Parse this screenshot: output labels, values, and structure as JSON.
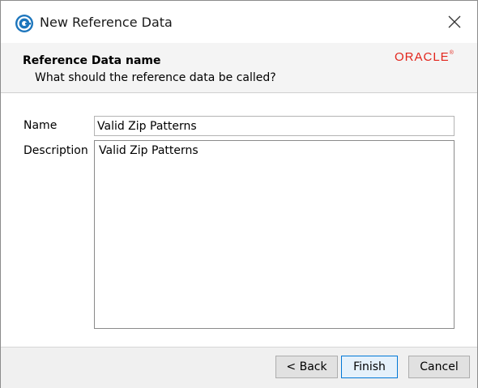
{
  "window": {
    "title": "New Reference Data",
    "close_glyph": "✕"
  },
  "header": {
    "title": "Reference Data name",
    "subtitle": "What should the reference data be called?",
    "logo_text": "ORACLE",
    "logo_color": "#e2241b"
  },
  "form": {
    "name_label": "Name",
    "name_value": "Valid Zip Patterns",
    "description_label": "Description",
    "description_value": "Valid Zip Patterns"
  },
  "footer": {
    "back_label": "< Back",
    "finish_label": "Finish",
    "cancel_label": "Cancel"
  },
  "colors": {
    "accent": "#0078d7",
    "app_icon": "#1c75bc"
  },
  "icons": {
    "app": "app-icon",
    "close": "close-icon"
  }
}
